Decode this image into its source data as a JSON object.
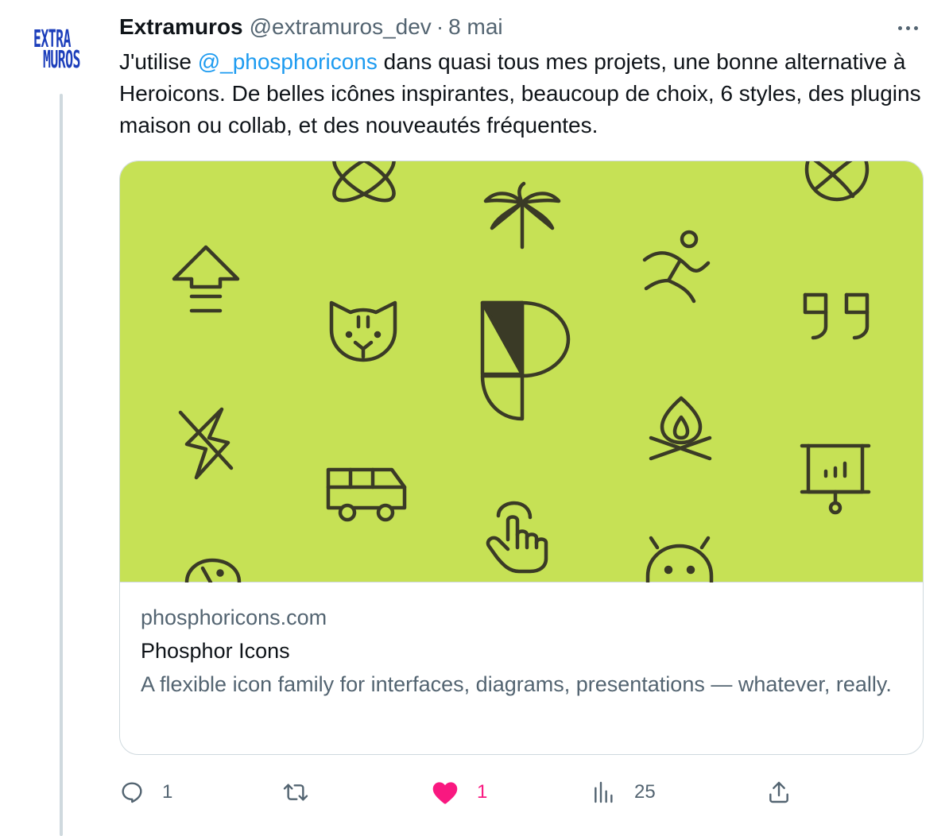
{
  "author": {
    "display_name": "Extramuros",
    "handle": "@extramuros_dev",
    "separator": "·",
    "date": "8 mai",
    "avatar_line1": "EXTRA",
    "avatar_line2": "MUROS"
  },
  "tweet": {
    "text_before": "J'utilise ",
    "mention": "@_phosphoricons",
    "text_after": " dans quasi tous mes projets, une bonne alternative à Heroicons. De belles icônes inspirantes, beaucoup de choix, 6 styles, des plugins maison ou collab, et des nouveautés fréquentes."
  },
  "card": {
    "domain": "phosphoricons.com",
    "title": "Phosphor Icons",
    "description": "A flexible icon family for interfaces, diagrams, presentations — whatever, really.",
    "image_bg": "#c6e155",
    "icon_color": "#3a3a26"
  },
  "actions": {
    "replies": "1",
    "retweets": "",
    "likes": "1",
    "views": "25"
  },
  "colors": {
    "text": "#0f1419",
    "secondary": "#536471",
    "link": "#1d9bf0",
    "like": "#f91880",
    "border": "#cfd9de",
    "avatar": "#1d3fbb"
  }
}
